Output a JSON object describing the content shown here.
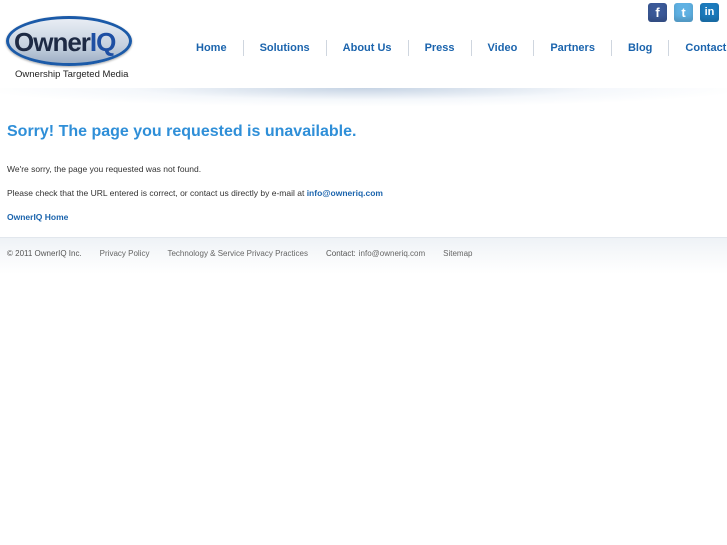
{
  "brand": {
    "logo_main": "Owner",
    "logo_accent": "IQ",
    "tagline": "Ownership Targeted Media"
  },
  "social": {
    "facebook": "f",
    "twitter": "t",
    "linkedin": "in",
    "colors": {
      "facebook": "#3b5998",
      "twitter": "#5fb1e3",
      "linkedin": "#1c7bbd"
    }
  },
  "nav": {
    "items": [
      "Home",
      "Solutions",
      "About Us",
      "Press",
      "Video",
      "Partners",
      "Blog",
      "Contact Us"
    ]
  },
  "content": {
    "heading": "Sorry! The page you requested is unavailable.",
    "line1": "We're sorry, the page you requested was not found.",
    "line2_prefix": "Please check that the URL entered is correct, or contact us directly by e-mail at ",
    "email": "info@owneriq.com",
    "home_link": "OwnerIQ Home"
  },
  "footer": {
    "copyright": "© 2011 OwnerIQ Inc.",
    "privacy": "Privacy Policy",
    "tech_privacy": "Technology & Service Privacy Practices",
    "contact_label": "Contact:",
    "contact_email": "info@owneriq.com",
    "sitemap": "Sitemap"
  },
  "colors": {
    "accent": "#1b64ad",
    "heading": "#2f8fd8"
  }
}
